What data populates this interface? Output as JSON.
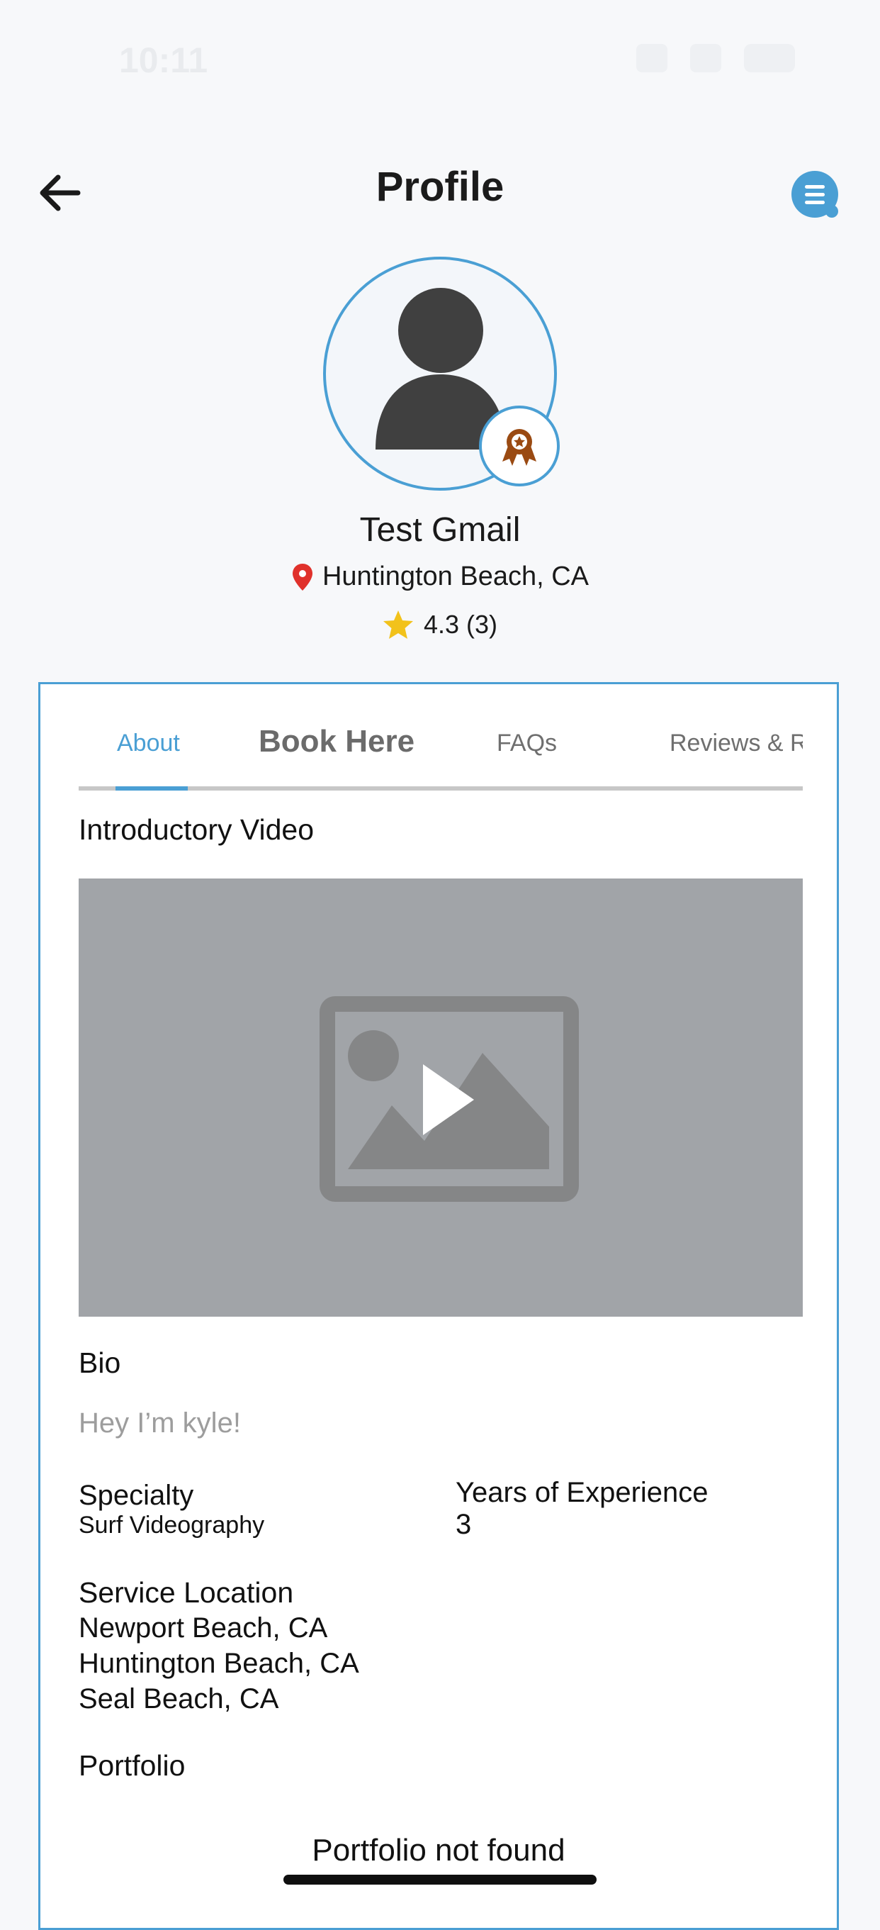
{
  "status_bar": {
    "time": "10:11"
  },
  "header": {
    "title": "Profile"
  },
  "profile": {
    "name": "Test Gmail",
    "location": "Huntington Beach, CA",
    "rating_text": "4.3 (3)"
  },
  "tabs": [
    {
      "label": "About",
      "active": true
    },
    {
      "label": "Book Here"
    },
    {
      "label": "FAQs"
    },
    {
      "label": "Reviews & Rati"
    }
  ],
  "about": {
    "intro_video_label": "Introductory Video",
    "bio_label": "Bio",
    "bio_text": "Hey I’m kyle!",
    "specialty_label": "Specialty",
    "specialty_value": "Surf Videography",
    "experience_label": "Years of Experience",
    "experience_value": "3",
    "service_location_label": "Service Location",
    "service_locations": [
      "Newport Beach, CA",
      "Huntington Beach, CA",
      "Seal Beach, CA"
    ],
    "portfolio_label": "Portfolio",
    "portfolio_empty": "Portfolio not found"
  },
  "colors": {
    "accent": "#4a9fd4",
    "star": "#f2c21b",
    "pin": "#e0312b",
    "badge": "#9a4a12",
    "video_bg": "#a1a4a8"
  },
  "icons": [
    "back-arrow-icon",
    "chat-menu-icon",
    "user-avatar-icon",
    "award-badge-icon",
    "location-pin-icon",
    "star-icon",
    "image-play-icon"
  ]
}
